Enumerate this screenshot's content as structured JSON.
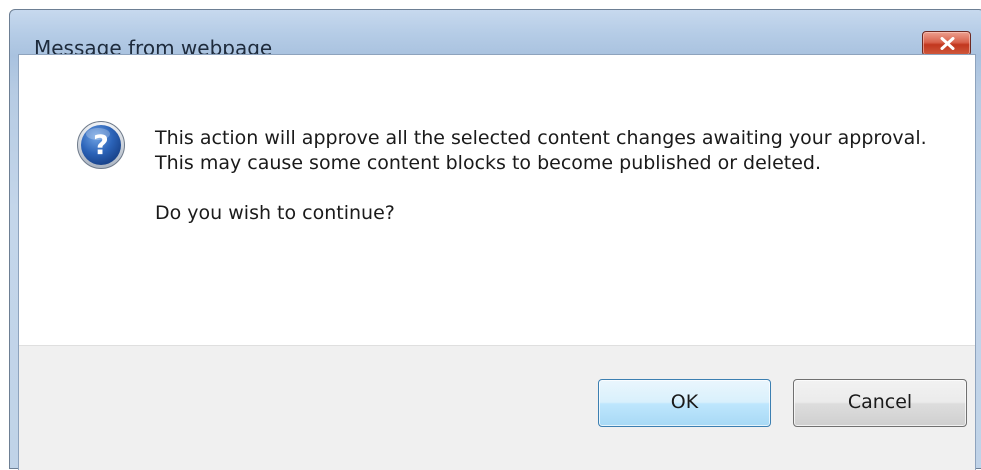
{
  "dialog": {
    "title": "Message from webpage",
    "icon": "question-icon",
    "message_lines": [
      "This action will approve all the selected content changes awaiting your approval.",
      "This may cause some content blocks to become published or deleted.",
      "Do you wish to continue?"
    ],
    "ok_label": "OK",
    "cancel_label": "Cancel",
    "close_icon": "close-icon"
  },
  "colors": {
    "frame": "#b5cce6",
    "close_button": "#c9472e",
    "ok_button_border": "#3c7fb1",
    "footer": "#f0f0f0"
  }
}
